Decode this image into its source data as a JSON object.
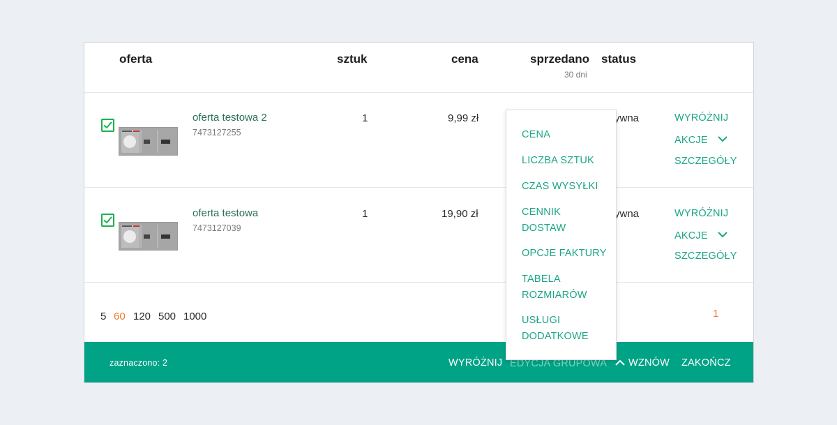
{
  "table": {
    "headers": {
      "oferta": "oferta",
      "sztuk": "sztuk",
      "cena": "cena",
      "sprzedano": "sprzedano",
      "sprzedano_sub": "30 dni",
      "status": "status"
    },
    "rows": [
      {
        "name": "oferta testowa 2",
        "id": "7473127255",
        "qty": "1",
        "price": "9,99 zł",
        "status": "ywna",
        "actions": {
          "highlight": "WYRÓŻNIJ",
          "actions": "AKCJE",
          "details": "SZCZEGÓŁY"
        }
      },
      {
        "name": "oferta testowa",
        "id": "7473127039",
        "qty": "1",
        "price": "19,90 zł",
        "status": "ywna",
        "actions": {
          "highlight": "WYRÓŻNIJ",
          "actions": "AKCJE",
          "details": "SZCZEGÓŁY"
        }
      }
    ]
  },
  "pagination": {
    "per_page": [
      "5",
      "60",
      "120",
      "500",
      "1000"
    ],
    "selected_per_page": "60",
    "current_page": "1"
  },
  "footer": {
    "selected_count": "zaznaczono: 2",
    "highlight": "WYRÓŻNIJ",
    "bulk_edit": "EDYCJA GRUPOWA",
    "resume": "WZNÓW",
    "finish": "ZAKOŃCZ"
  },
  "dropdown": {
    "items": [
      "CENA",
      "LICZBA SZTUK",
      "CZAS WYSYŁKI",
      "CENNIK DOSTAW",
      "OPCJE FAKTURY",
      "TABELA ROZMIARÓW",
      "USŁUGI DODATKOWE"
    ]
  },
  "colors": {
    "accent": "#00a386",
    "link": "#1ba686",
    "checkbox": "#1cb050",
    "active_page": "#f07a2e"
  }
}
